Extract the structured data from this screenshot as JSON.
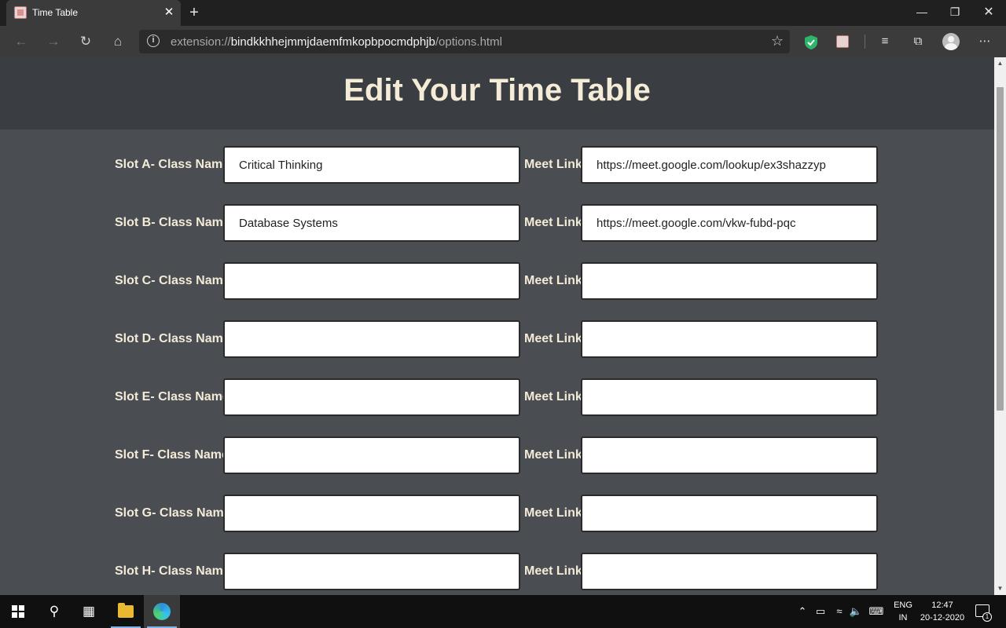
{
  "browser": {
    "tab_title": "Time Table",
    "tab_close": "✕",
    "new_tab": "+",
    "url_scheme": "extension://",
    "url_host": "bindkkhhejmmjdaemfmkopbpocmdphjb",
    "url_path": "/options.html"
  },
  "page": {
    "title": "Edit Your Time Table",
    "meet_label": "Meet Link:",
    "slots": [
      {
        "label": "Slot A- Class Name:",
        "class_name": "Critical Thinking",
        "meet_link": "https://meet.google.com/lookup/ex3shazzyp"
      },
      {
        "label": "Slot B- Class Name:",
        "class_name": "Database Systems",
        "meet_link": "https://meet.google.com/vkw-fubd-pqc"
      },
      {
        "label": "Slot C- Class Name:",
        "class_name": "",
        "meet_link": ""
      },
      {
        "label": "Slot D- Class Name:",
        "class_name": "",
        "meet_link": ""
      },
      {
        "label": "Slot E- Class Name:",
        "class_name": "",
        "meet_link": ""
      },
      {
        "label": "Slot F- Class Name:",
        "class_name": "",
        "meet_link": ""
      },
      {
        "label": "Slot G- Class Name:",
        "class_name": "",
        "meet_link": ""
      },
      {
        "label": "Slot H- Class Name:",
        "class_name": "",
        "meet_link": ""
      }
    ]
  },
  "taskbar": {
    "lang_top": "ENG",
    "lang_bottom": "IN",
    "time": "12:47",
    "date": "20-12-2020",
    "notification_count": "1"
  },
  "colors": {
    "page_bg": "#4a4d51",
    "header_bg": "#3a3d41",
    "label_text": "#f3ead8",
    "title_text": "#f5ecd7"
  }
}
